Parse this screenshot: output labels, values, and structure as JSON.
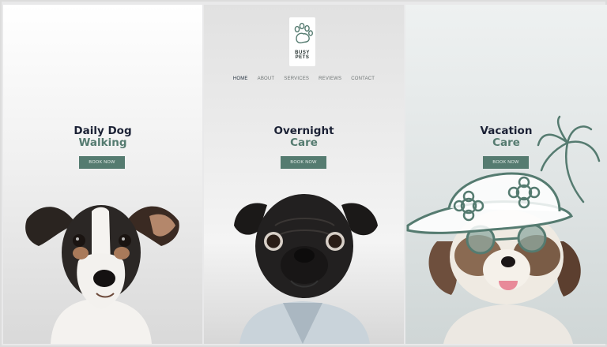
{
  "brand": {
    "logo_text": "BUSY PETS"
  },
  "nav": {
    "items": [
      "HOME",
      "ABOUT",
      "SERVICES",
      "REVIEWS",
      "CONTACT"
    ],
    "active": "HOME"
  },
  "services": [
    {
      "title_line1": "Daily Dog",
      "title_line2": "Walking",
      "button": "BOOK NOW",
      "image": "jack-russell-terrier-photo"
    },
    {
      "title_line1": "Overnight",
      "title_line2": "Care",
      "button": "BOOK NOW",
      "image": "pug-in-denim-jacket-photo"
    },
    {
      "title_line1": "Vacation",
      "title_line2": "Care",
      "button": "BOOK NOW",
      "image": "shih-tzu-with-doodle-sunhat-photo"
    }
  ],
  "colors": {
    "accent": "#557b70",
    "heading": "#1b2135",
    "background": "#e9e9ea"
  }
}
